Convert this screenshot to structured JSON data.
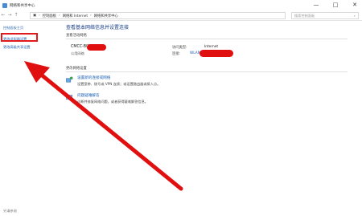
{
  "window": {
    "title": "网络和共享中心",
    "controls": [
      "—",
      "□",
      "✕"
    ]
  },
  "address": {
    "crumbs": [
      "控制面板",
      "网络和 Internet",
      "网络和共享中心"
    ],
    "search_placeholder": "搜索控制面板"
  },
  "sidebar": {
    "items": [
      {
        "label": "控制面板主页"
      },
      {
        "label": "更改适配器设置"
      },
      {
        "label": "更改高级共享设置"
      }
    ],
    "footer": "另请参阅"
  },
  "main": {
    "heading": "查看基本网络信息并设置连接",
    "active_section": "查看活动网络",
    "network": {
      "name": "CMCC-B0U",
      "type": "公用网络",
      "access_type_label": "访问类型:",
      "access_type_value": "Internet",
      "connection_label": "连接:",
      "connection_value": "WLAN"
    },
    "change_section": "更改网络设置",
    "tasks": [
      {
        "link": "设置新的连接或网络",
        "desc": "设置宽带、拨号或 VPN 连接；或设置路由器或接入点。",
        "icon": "new-connection-icon"
      },
      {
        "link": "问题疑难解答",
        "desc": "诊断并修复网络问题，或者获得疑难解答信息。",
        "icon": "troubleshoot-icon"
      }
    ]
  },
  "colors": {
    "annotation": "#e01010",
    "link": "#1a5fb4"
  }
}
